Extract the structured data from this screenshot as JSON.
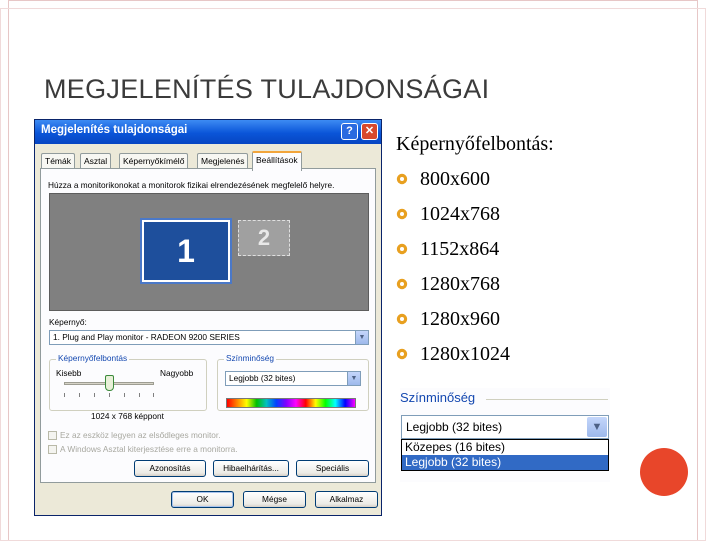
{
  "slide": {
    "title": "MEGJELENÍTÉS TULAJDONSÁGAI"
  },
  "dialog": {
    "title": "Megjelenítés tulajdonságai",
    "help_glyph": "?",
    "close_glyph": "✕",
    "tabs": [
      "Témák",
      "Asztal",
      "Képernyőkímélő",
      "Megjelenés",
      "Beállítások"
    ],
    "active_tab": "Beállítások",
    "instruction": "Húzza a monitorikonokat a monitorok fizikai elrendezésének megfelelő helyre.",
    "monitors": [
      "1",
      "2"
    ],
    "display_label": "Képernyő:",
    "display_value": "1. Plug and Play monitor - RADEON 9200 SERIES",
    "resolution": {
      "label": "Képernyőfelbontás",
      "less": "Kisebb",
      "more": "Nagyobb",
      "value": "1024 x 768 képpont",
      "slider_fraction": 0.5
    },
    "color_quality": {
      "label": "Színminőség",
      "value": "Legjobb (32 bites)"
    },
    "checkboxes": [
      "Ez az eszköz legyen az elsődleges monitor.",
      "A Windows Asztal kiterjesztése erre a monitorra."
    ],
    "buttons": [
      "Azonosítás",
      "Hibaelhárítás...",
      "Speciális"
    ],
    "footer_buttons": [
      "OK",
      "Mégse",
      "Alkalmaz"
    ]
  },
  "list": {
    "heading": "Képernyőfelbontás:",
    "items": [
      "800x600",
      "1024x768",
      "1152x864",
      "1280x768",
      "1280x960",
      "1280x1024"
    ],
    "bullet_color": "#e8a020"
  },
  "zoom_panel": {
    "label": "Színminőség",
    "selected": "Legjobb (32 bites)",
    "options": [
      "Közepes (16 bites)",
      "Legjobb (32 bites)"
    ]
  },
  "colors": {
    "accent_circle": "#e8462a",
    "xp_title": "#0a55d8",
    "selection": "#316ac5"
  }
}
